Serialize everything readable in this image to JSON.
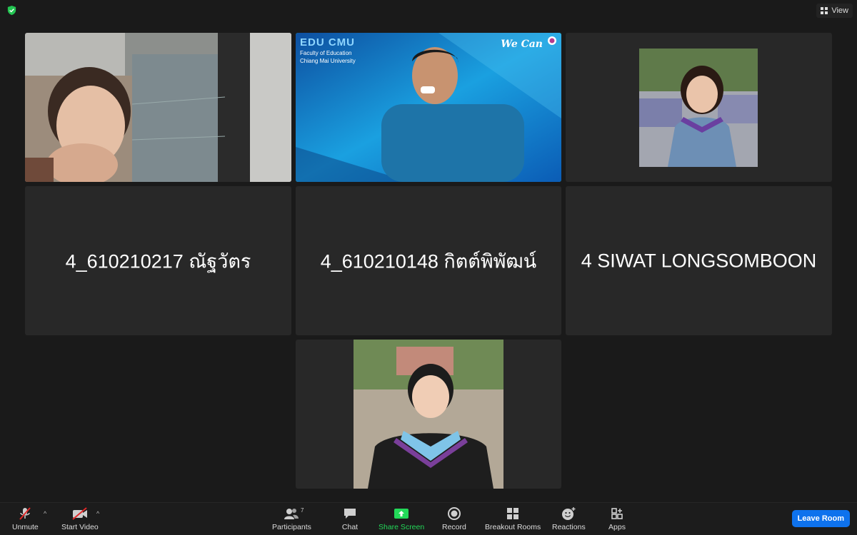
{
  "topbar": {
    "view_label": "View",
    "security_icon": "shield-check-icon",
    "view_icon": "grid-icon"
  },
  "tiles": {
    "t2": {
      "banner_title": "EDU CMU",
      "banner_line1": "Faculty of Education",
      "banner_line2": "Chiang Mai University",
      "slogan": "We Can"
    },
    "t4": {
      "name": "4_610210217 ณัฐวัตร"
    },
    "t5": {
      "name": "4_610210148 กิตต์พิพัฒน์"
    },
    "t6": {
      "name": "4 SIWAT LONGSOMBOON"
    }
  },
  "toolbar": {
    "unmute": "Unmute",
    "start_video": "Start Video",
    "participants": "Participants",
    "participants_count": "7",
    "chat": "Chat",
    "share_screen": "Share Screen",
    "record": "Record",
    "breakout_rooms": "Breakout Rooms",
    "reactions": "Reactions",
    "apps": "Apps",
    "leave_room": "Leave Room",
    "caret": "^"
  },
  "colors": {
    "active_speaker": "#23d959",
    "share_green": "#23d959",
    "leave_blue": "#0e72ed",
    "muted_red": "#e02828"
  }
}
